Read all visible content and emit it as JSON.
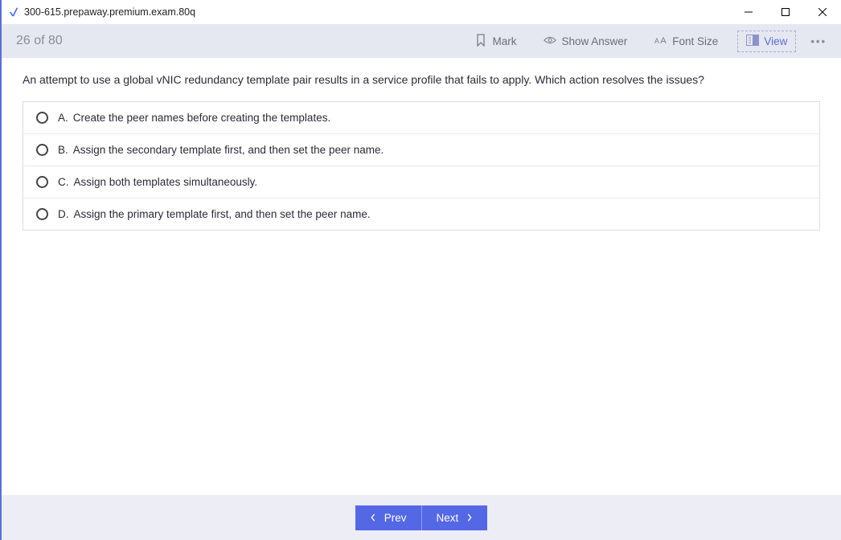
{
  "window": {
    "title": "300-615.prepaway.premium.exam.80q"
  },
  "toolbar": {
    "counter": "26 of 80",
    "mark": "Mark",
    "show_answer": "Show Answer",
    "font_size": "Font Size",
    "view": "View"
  },
  "question": {
    "text": "An attempt to use a global vNIC redundancy template pair results in a service profile that fails to apply. Which action resolves the issues?",
    "options": [
      {
        "letter": "A.",
        "text": "Create the peer names before creating the templates."
      },
      {
        "letter": "B.",
        "text": "Assign the secondary template first, and then set the peer name."
      },
      {
        "letter": "C.",
        "text": "Assign both templates simultaneously."
      },
      {
        "letter": "D.",
        "text": "Assign the primary template first, and then set the peer name."
      }
    ]
  },
  "nav": {
    "prev": "Prev",
    "next": "Next"
  }
}
